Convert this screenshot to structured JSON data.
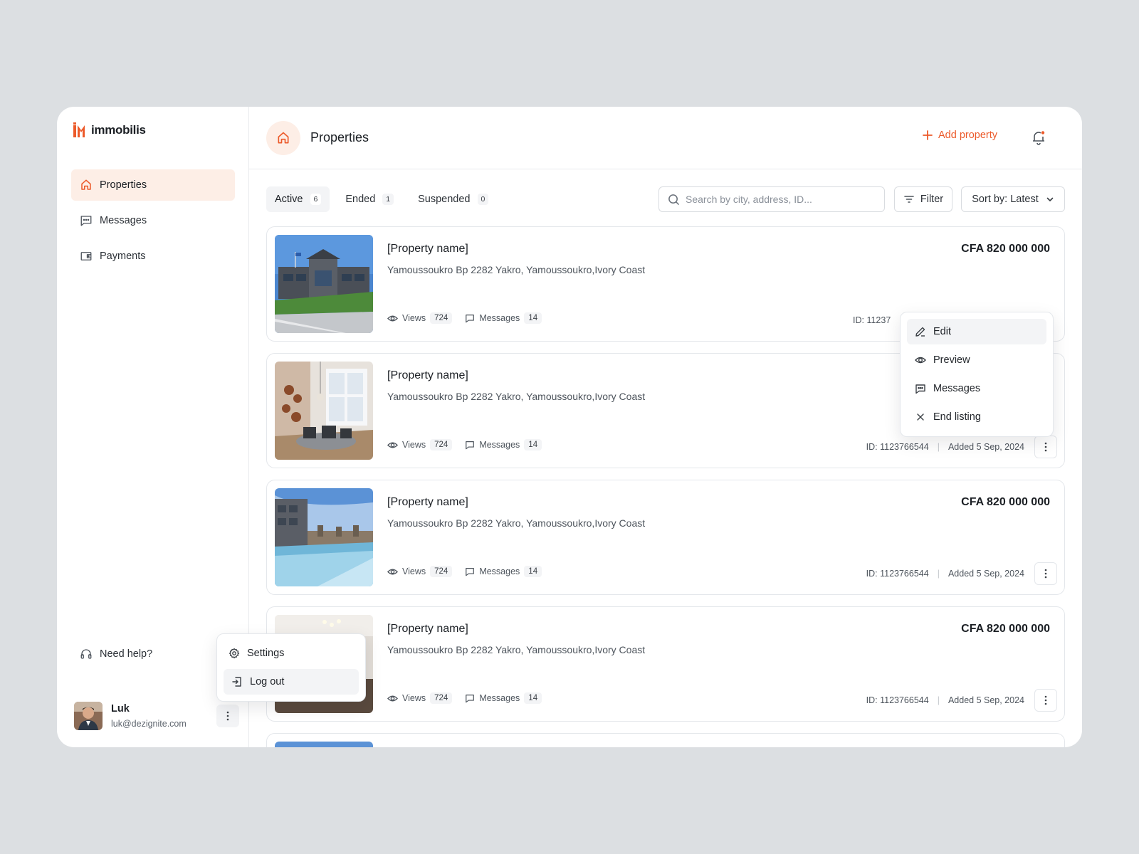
{
  "brand": {
    "name": "immobilis",
    "accent": "#ec5a2a"
  },
  "sidebar": {
    "items": [
      {
        "label": "Properties",
        "icon": "home-icon",
        "active": true
      },
      {
        "label": "Messages",
        "icon": "message-icon",
        "active": false
      },
      {
        "label": "Payments",
        "icon": "wallet-icon",
        "active": false
      }
    ],
    "help_label": "Need help?"
  },
  "user": {
    "name": "Luk",
    "email": "luk@dezignite.com"
  },
  "user_menu": {
    "settings_label": "Settings",
    "logout_label": "Log out"
  },
  "header": {
    "title": "Properties",
    "add_label": "Add property"
  },
  "tabs": [
    {
      "label": "Active",
      "count": "6"
    },
    {
      "label": "Ended",
      "count": "1"
    },
    {
      "label": "Suspended",
      "count": "0"
    }
  ],
  "search": {
    "placeholder": "Search by city, address, ID..."
  },
  "toolbar": {
    "filter_label": "Filter",
    "sort_label": "Sort by: Latest"
  },
  "listings": [
    {
      "name": "[Property name]",
      "address": "Yamoussoukro Bp 2282 Yakro, Yamoussoukro,Ivory Coast",
      "price": "CFA 820 000 000",
      "views_label": "Views",
      "views": "724",
      "messages_label": "Messages",
      "messages": "14",
      "id": "ID: 11237",
      "added": ""
    },
    {
      "name": "[Property name]",
      "address": "Yamoussoukro Bp 2282 Yakro, Yamoussoukro,Ivory Coast",
      "price": "",
      "views_label": "Views",
      "views": "724",
      "messages_label": "Messages",
      "messages": "14",
      "id": "ID: 1123766544",
      "added": "Added 5 Sep, 2024"
    },
    {
      "name": "[Property name]",
      "address": "Yamoussoukro Bp 2282 Yakro, Yamoussoukro,Ivory Coast",
      "price": "CFA 820 000 000",
      "views_label": "Views",
      "views": "724",
      "messages_label": "Messages",
      "messages": "14",
      "id": "ID: 1123766544",
      "added": "Added 5 Sep, 2024"
    },
    {
      "name": "[Property name]",
      "address": "Yamoussoukro Bp 2282 Yakro, Yamoussoukro,Ivory Coast",
      "price": "CFA 820 000 000",
      "views_label": "Views",
      "views": "724",
      "messages_label": "Messages",
      "messages": "14",
      "id": "ID: 1123766544",
      "added": "Added 5 Sep, 2024"
    }
  ],
  "listing_menu": [
    {
      "label": "Edit",
      "icon": "pencil-icon"
    },
    {
      "label": "Preview",
      "icon": "eye-icon"
    },
    {
      "label": "Messages",
      "icon": "message-icon"
    },
    {
      "label": "End listing",
      "icon": "close-icon"
    }
  ]
}
